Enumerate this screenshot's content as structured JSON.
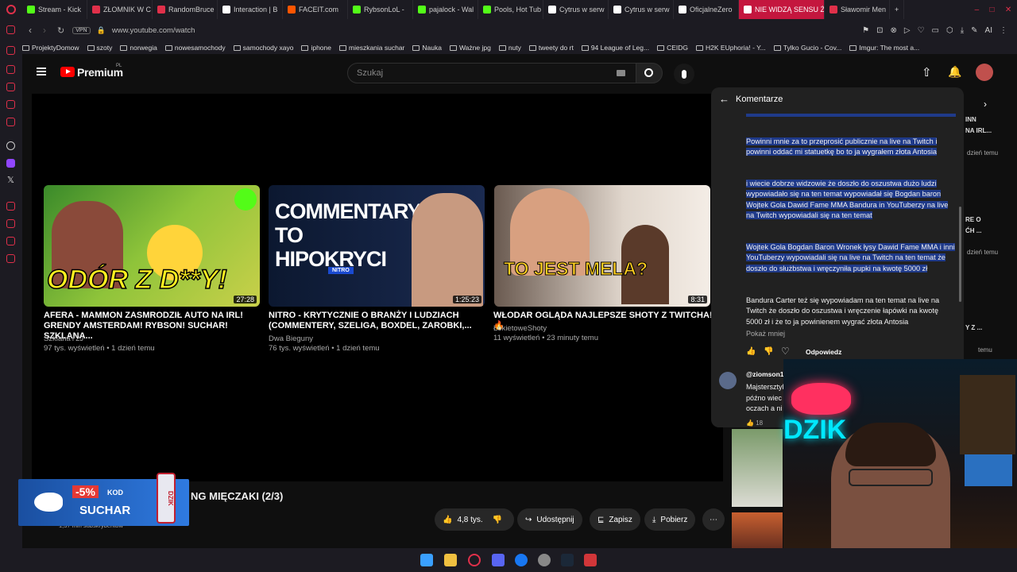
{
  "browser": {
    "tabs": [
      {
        "label": "Stream - Kick",
        "color": "#53fc18"
      },
      {
        "label": "ZŁOMNIK W C",
        "color": "#e0304a"
      },
      {
        "label": "RandomBruce",
        "color": "#e0304a"
      },
      {
        "label": "Interaction | B",
        "color": "#ffffff"
      },
      {
        "label": "FACEIT.com",
        "color": "#ff5500"
      },
      {
        "label": "RybsonLoL -",
        "color": "#53fc18"
      },
      {
        "label": "pajalock - Wal",
        "color": "#53fc18"
      },
      {
        "label": "Pools, Hot Tub",
        "color": "#53fc18"
      },
      {
        "label": "Cytrus w serw",
        "color": "#ffffff"
      },
      {
        "label": "Cytrus w serw",
        "color": "#ffffff"
      },
      {
        "label": "OficjalneZero",
        "color": "#ffffff"
      },
      {
        "label": "NIE WIDZĄ SENSU ŻYCIA",
        "color": "#ffffff"
      },
      {
        "label": "Sławomir Men",
        "color": "#e0304a"
      }
    ],
    "url": "www.youtube.com/watch",
    "vpn": "VPN",
    "ai": "AI",
    "bookmarks": [
      "ProjektyDomow",
      "szoty",
      "norwegia",
      "nowesamochody",
      "samochody xayo",
      "iphone",
      "mieszkania suchar",
      "Nauka",
      "Ważne jpg",
      "nuty",
      "tweety do rt",
      "94 League of Leg...",
      "CEIDG",
      "H2K EUphoria! - Y...",
      "Tylko Gucio - Cov...",
      "Imgur: The most a..."
    ]
  },
  "youtube": {
    "logo": "Premium",
    "logo_sup": "PL",
    "search_placeholder": "Szukaj"
  },
  "videos": [
    {
      "thumb_text": "ODÓR Z D**Y!",
      "title": "AFERA - MAMMON ZASMRODZIŁ AUTO NA IRL! GRENDY AMSTERDAM! RYBSON! SUCHAR! SZKLANA...",
      "channel": "SzklanaY2J",
      "meta": "97 tys. wyświetleń • 1 dzień temu",
      "duration": "27:28"
    },
    {
      "thumb_text": "COMMENTARY TO HIPOKRYCI",
      "title": "NITRO - KRYTYCZNIE O BRANŻY I LUDZIACH (COMMENTERY, SZELIGA, BOXDEL, ZAROBKI,...",
      "channel": "Dwa Bieguny",
      "meta": "76 tys. wyświetleń • 1 dzień temu",
      "duration": "1:25:23",
      "badge": "NITRO"
    },
    {
      "thumb_text": "TO JEST MELA?",
      "title": "WŁODAR OGLĄDA NAJLEPSZE SHOTY Z TWITCHA! 🔥",
      "channel": "ŁokietoweShoty",
      "meta": "11 wyświetleń • 23 minuty temu",
      "duration": "8:31"
    }
  ],
  "below_player": {
    "title_fragment": "NG MIĘCZAKI (2/3)",
    "subscribers": "1,37 mln subskrybentów",
    "like_count": "4,8 tys.",
    "share": "Udostępnij",
    "save": "Zapisz",
    "download": "Pobierz"
  },
  "ad": {
    "discount": "-5%",
    "kod": "KOD",
    "code": "SUCHAR",
    "brand": "DZIK"
  },
  "comments": {
    "header": "Komentarze",
    "paragraphs": [
      "Powinni mnie za to przeprosić publicznie na live na Twitch i powinni oddać mi statuetkę bo to ja wygrałem złota Antosia",
      "i wiecie dobrze widzowie że doszło do oszustwa dużo ludzi wypowiadało się na ten temat wypowiadał się Bogdan baron Wojtek Gola   Dawid Fame MMA Bandura in YouTuberzy na live na Twitch wypowiadali się na ten temat",
      "Wojtek Gola Bogdan Baron Wronek łysy Dawid Fame MMA i inni YouTuberzy wypowiadali się na live na Twitch na ten temat że doszło do służbstwa i wręczyniła pupki na kwotę 5000 zł",
      "Bandura Carter też się wypowiadam na ten temat na live na Twitch że doszło do oszustwa i wręczenie łapówki na kwotę 5000 zł i że to ja powinienem wygrać złota Antosia"
    ],
    "show_less": "Pokaż mniej",
    "reply": "Odpowiedz",
    "next_author": "@ziomson1",
    "next_text": [
      "Majstersztyk",
      "późno wiec",
      "oczach a ni"
    ],
    "next_likes": "18"
  },
  "related_side": [
    {
      "text": "INN",
      "sub": "NA IRL...",
      "meta": "dzień temu"
    },
    {
      "text": "RE O",
      "sub": "ĆH ...",
      "meta": "dzień temu"
    },
    {
      "text": "Y Z ...",
      "sub": "",
      "meta": "temu"
    },
    {
      "text": "",
      "sub": "",
      "meta": "temu"
    }
  ],
  "stream_overlay": {
    "brand": "DZIK"
  }
}
